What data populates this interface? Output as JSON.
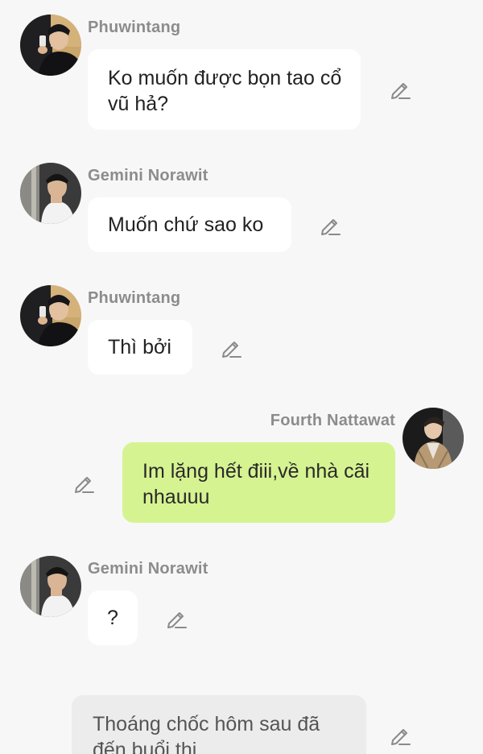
{
  "messages": [
    {
      "sender": "Phuwintang",
      "avatar": "avatar-phuwintang",
      "text": "Ko muốn được bọn tao cổ vũ hả?",
      "side": "left"
    },
    {
      "sender": "Gemini Norawit",
      "avatar": "avatar-gemini",
      "text": "Muốn chứ sao ko",
      "side": "left"
    },
    {
      "sender": "Phuwintang",
      "avatar": "avatar-phuwintang",
      "text": "Thì bởi",
      "side": "left"
    },
    {
      "sender": "Fourth Nattawat",
      "avatar": "avatar-fourth",
      "text": "Im lặng hết điii,về nhà cãi nhauuu",
      "side": "right"
    },
    {
      "sender": "Gemini Norawit",
      "avatar": "avatar-gemini",
      "text": "?",
      "side": "left"
    },
    {
      "sender": "",
      "avatar": "",
      "text": "Thoáng chốc hôm sau đã đến buổi thi",
      "side": "narration"
    }
  ],
  "icons": {
    "edit": "pencil-icon"
  },
  "colors": {
    "background": "#f7f7f7",
    "bubble_other": "#ffffff",
    "bubble_mine": "#d6f391",
    "bubble_narration": "#ececec",
    "sender_name": "#8c8c8c"
  }
}
